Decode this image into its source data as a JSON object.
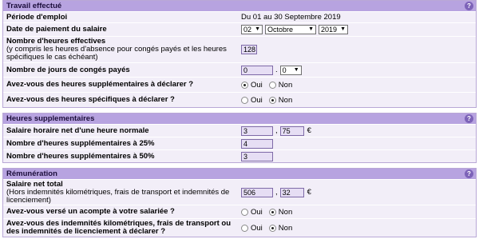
{
  "help_glyph": "?",
  "travail": {
    "title": "Travail effectué",
    "periode_label": "Période d'emploi",
    "periode_value": "Du 01 au 30 Septembre 2019",
    "date_label": "Date de paiement du salaire",
    "date_day": "02",
    "date_month": "Octobre",
    "date_year": "2019",
    "heures_label": "Nombre d'heures effectives",
    "heures_sub": "(y compris les heures d'absence pour congés payés et les heures spécifiques le cas échéant)",
    "heures_value": "128",
    "conges_label": "Nombre de jours de congés payés",
    "conges_int": "0",
    "conges_dec": "0",
    "supp_label": "Avez-vous des heures supplémentaires à déclarer ?",
    "spec_label": "Avez-vous des heures spécifiques à déclarer ?",
    "oui": "Oui",
    "non": "Non"
  },
  "heures_supp": {
    "title": "Heures supplementaires",
    "taux_label": "Salaire horaire net d'une heure normale",
    "taux_int": "3",
    "taux_dec": "75",
    "currency": "€",
    "h25_label": "Nombre d'heures supplémentaires à 25%",
    "h25_value": "4",
    "h50_label": "Nombre d'heures supplémentaires à 50%",
    "h50_value": "3"
  },
  "remuneration": {
    "title": "Rémunération",
    "net_label": "Salaire net total",
    "net_sub": "(Hors indemnités kilométriques, frais de transport et indemnités de licenciement)",
    "net_int": "506",
    "net_dec": "32",
    "currency": "€",
    "acompte_label": "Avez-vous versé un acompte à votre salariée ?",
    "indem_label": "Avez-vous des indemnités kilométriques, frais de transport ou des indemnités de licenciement à déclarer ?",
    "oui": "Oui",
    "non": "Non"
  },
  "selections": {
    "supp": "Oui",
    "spec": "Non",
    "acompte": "Non",
    "indem": "Non"
  }
}
